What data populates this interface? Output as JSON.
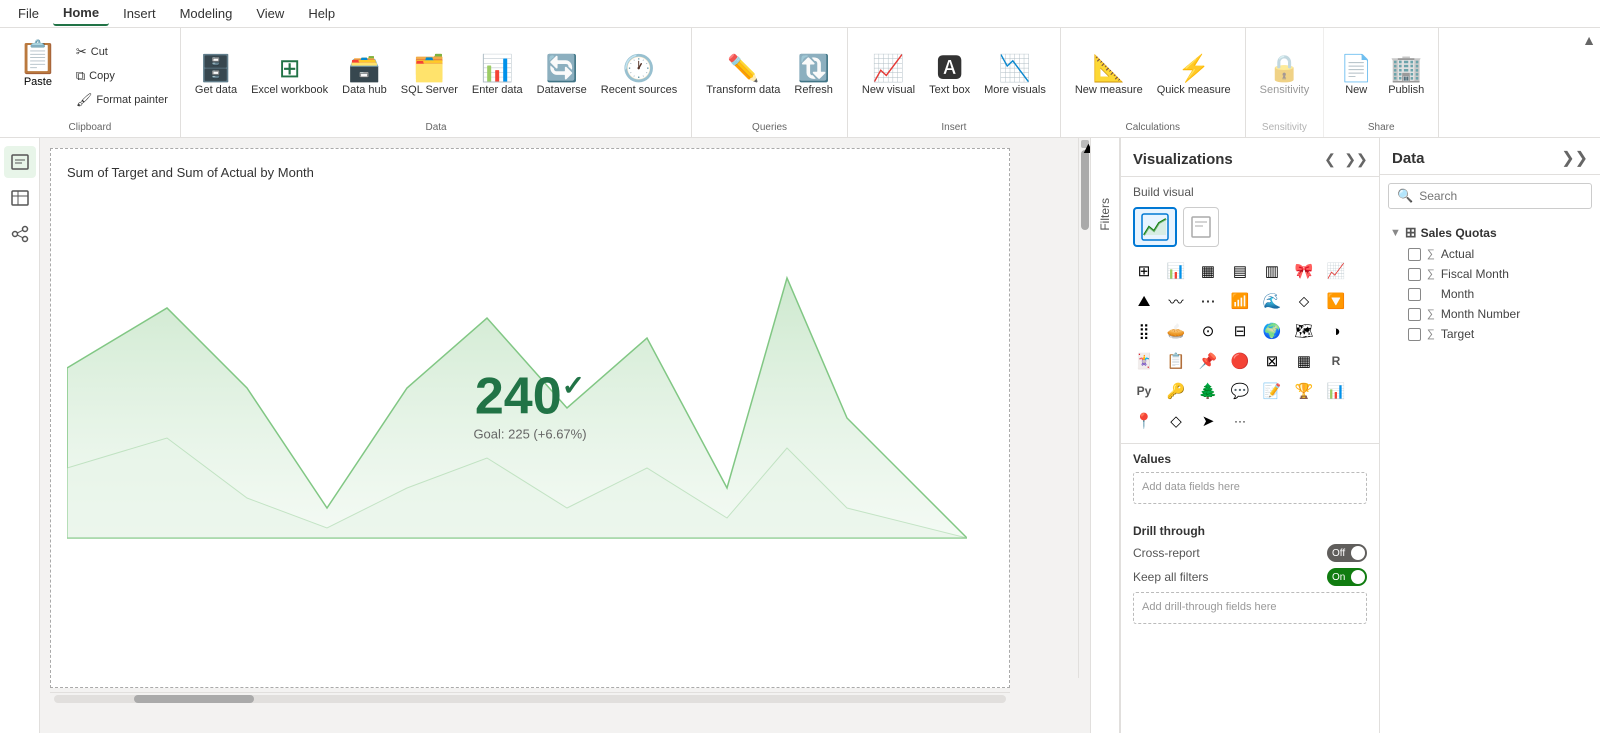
{
  "menu": {
    "items": [
      {
        "label": "File",
        "active": false
      },
      {
        "label": "Home",
        "active": true
      },
      {
        "label": "Insert",
        "active": false
      },
      {
        "label": "Modeling",
        "active": false
      },
      {
        "label": "View",
        "active": false
      },
      {
        "label": "Help",
        "active": false
      }
    ]
  },
  "ribbon": {
    "clipboard": {
      "label": "Clipboard",
      "paste": "Paste",
      "cut": "Cut",
      "copy": "Copy",
      "format_painter": "Format painter"
    },
    "data": {
      "label": "Data",
      "get_data": "Get data",
      "excel_workbook": "Excel workbook",
      "data_hub": "Data hub",
      "sql_server": "SQL Server",
      "enter_data": "Enter data",
      "dataverse": "Dataverse",
      "recent_sources": "Recent sources"
    },
    "queries": {
      "label": "Queries",
      "transform_data": "Transform data",
      "refresh": "Refresh"
    },
    "insert": {
      "label": "Insert",
      "new_visual": "New visual",
      "text_box": "Text box",
      "more_visuals": "More visuals"
    },
    "calculations": {
      "label": "Calculations",
      "new_measure": "New measure",
      "quick_measure": "Quick measure"
    },
    "sensitivity": {
      "label": "Sensitivity",
      "sensitivity": "Sensitivity"
    },
    "share": {
      "label": "Share",
      "publish": "Publish",
      "new": "New"
    }
  },
  "chart": {
    "title": "Sum of Target and Sum of Actual by Month",
    "value": "240",
    "goal_text": "Goal: 225 (+6.67%)"
  },
  "visualizations": {
    "title": "Visualizations",
    "build_visual": "Build visual",
    "values_label": "Values",
    "values_placeholder": "Add data fields here",
    "drillthrough": {
      "label": "Drill through",
      "cross_report": "Cross-report",
      "cross_report_state": "Off",
      "keep_filters": "Keep all filters",
      "keep_filters_state": "On",
      "drillthrough_placeholder": "Add drill-through fields here"
    }
  },
  "data_panel": {
    "title": "Data",
    "search_placeholder": "Search",
    "tables": [
      {
        "name": "Sales Quotas",
        "fields": [
          {
            "name": "Actual",
            "type": "sigma"
          },
          {
            "name": "Fiscal Month",
            "type": "sigma"
          },
          {
            "name": "Month",
            "type": "none"
          },
          {
            "name": "Month Number",
            "type": "sigma"
          },
          {
            "name": "Target",
            "type": "sigma"
          }
        ]
      }
    ]
  },
  "filters": {
    "label": "Filters"
  }
}
